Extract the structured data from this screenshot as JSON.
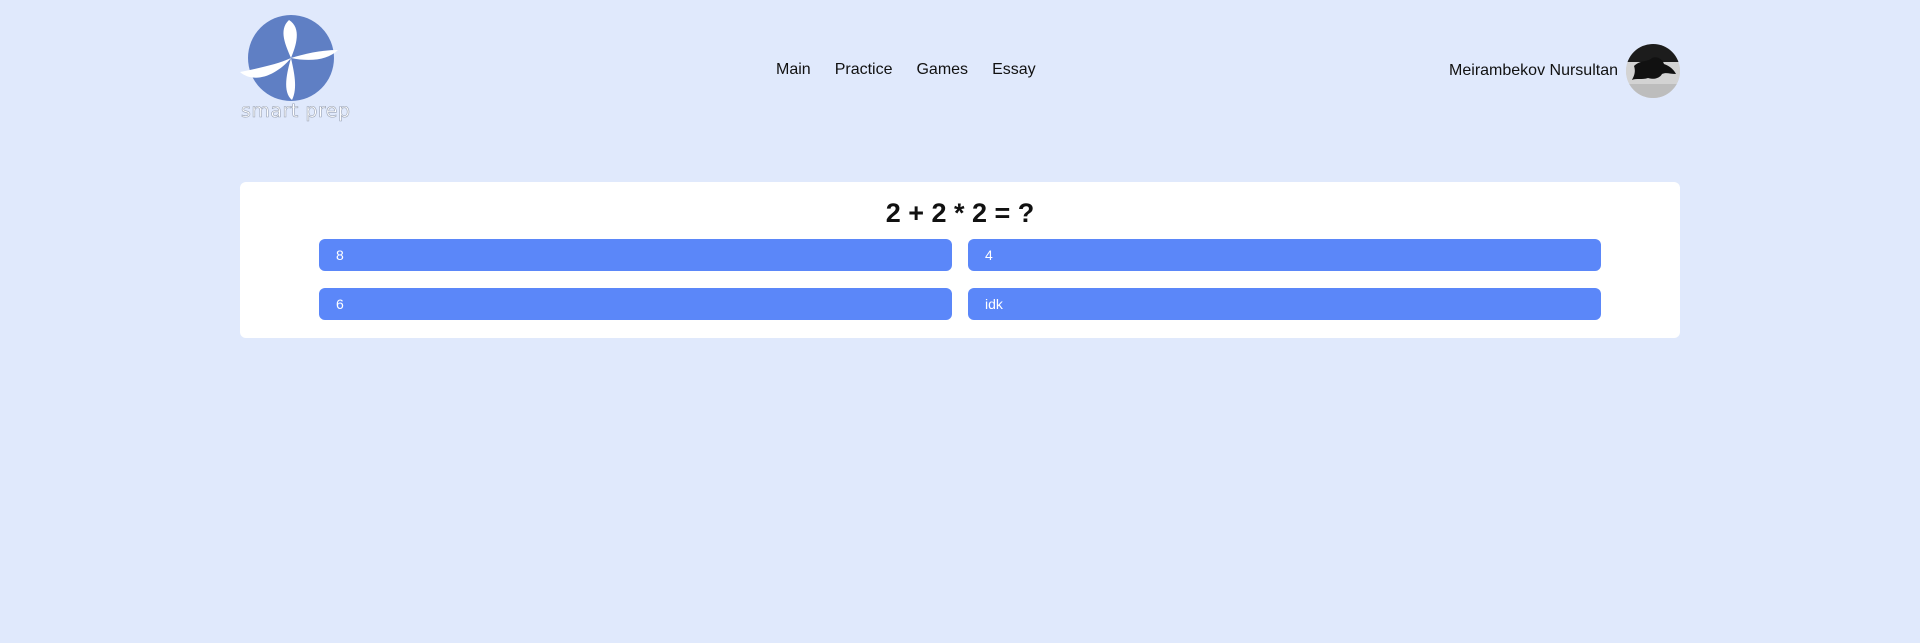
{
  "brand": {
    "name": "smart prep",
    "circle_color": "#5f7fc4"
  },
  "nav": {
    "items": [
      {
        "label": "Main"
      },
      {
        "label": "Practice"
      },
      {
        "label": "Games"
      },
      {
        "label": "Essay"
      }
    ]
  },
  "user": {
    "name": "Meirambekov Nursultan"
  },
  "quiz": {
    "question": "2 + 2 * 2 = ?",
    "answers": [
      {
        "label": "8"
      },
      {
        "label": "4"
      },
      {
        "label": "6"
      },
      {
        "label": "idk"
      }
    ],
    "answer_color": "#5b87f9"
  },
  "colors": {
    "background": "#e0e9fc",
    "card": "#ffffff",
    "text": "#111111"
  }
}
